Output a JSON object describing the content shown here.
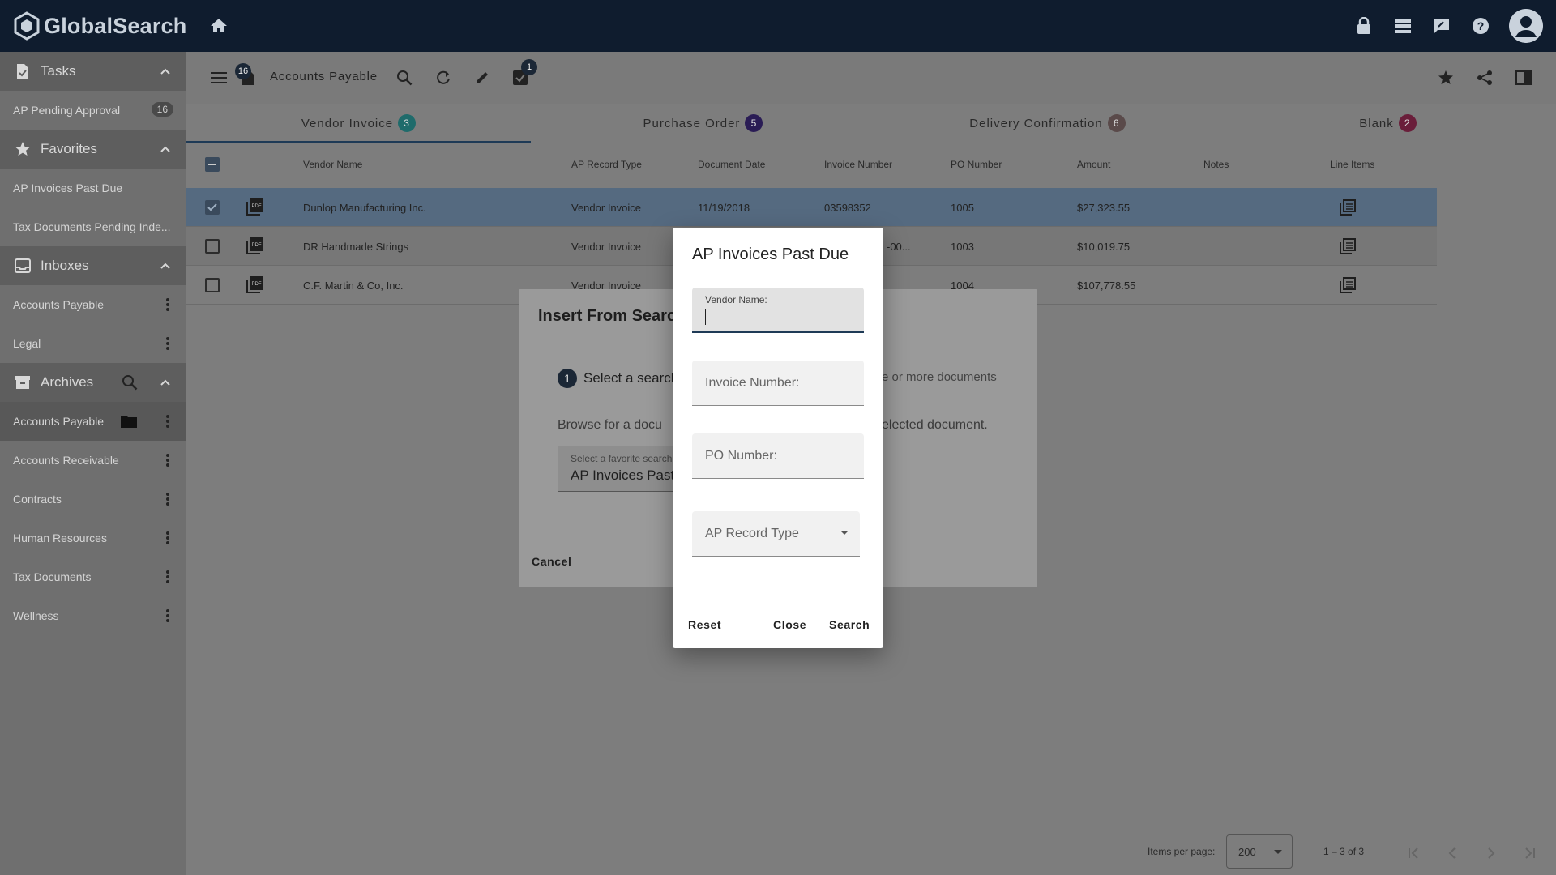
{
  "app": {
    "title": "GlobalSearch"
  },
  "sidebar": {
    "tasks": {
      "label": "Tasks",
      "items": [
        {
          "label": "AP Pending Approval",
          "count": "16"
        }
      ]
    },
    "favorites": {
      "label": "Favorites",
      "items": [
        {
          "label": "AP Invoices Past Due"
        },
        {
          "label": "Tax Documents Pending Inde..."
        }
      ]
    },
    "inboxes": {
      "label": "Inboxes",
      "items": [
        {
          "label": "Accounts Payable"
        },
        {
          "label": "Legal"
        }
      ]
    },
    "archives": {
      "label": "Archives",
      "items": [
        {
          "label": "Accounts Payable"
        },
        {
          "label": "Accounts Receivable"
        },
        {
          "label": "Contracts"
        },
        {
          "label": "Human Resources"
        },
        {
          "label": "Tax Documents"
        },
        {
          "label": "Wellness"
        }
      ]
    }
  },
  "toolbar": {
    "title": "Accounts Payable",
    "tasks_count": "16",
    "approve_count": "1"
  },
  "tabs": [
    {
      "label": "Vendor Invoice",
      "count": "3",
      "color": "#1f6b6b"
    },
    {
      "label": "Purchase Order",
      "count": "5",
      "color": "#2a1c55"
    },
    {
      "label": "Delivery Confirmation",
      "count": "6",
      "color": "#5a4a4a"
    },
    {
      "label": "Blank",
      "count": "2",
      "color": "#6a1e3a"
    }
  ],
  "table": {
    "columns": [
      "Vendor Name",
      "AP Record Type",
      "Document Date",
      "Invoice Number",
      "PO Number",
      "Amount",
      "Notes",
      "Line Items"
    ],
    "rows": [
      {
        "vendor": "Dunlop Manufacturing Inc.",
        "type": "Vendor Invoice",
        "date": "11/19/2018",
        "invoice": "03598352",
        "po": "1005",
        "amount": "$27,323.55",
        "selected": true
      },
      {
        "vendor": "DR Handmade Strings",
        "type": "Vendor Invoice",
        "date": "",
        "invoice": "-00...",
        "po": "1003",
        "amount": "$10,019.75",
        "selected": false
      },
      {
        "vendor": "C.F. Martin & Co, Inc.",
        "type": "Vendor Invoice",
        "date": "",
        "invoice": "",
        "po": "1004",
        "amount": "$107,778.55",
        "selected": false
      }
    ]
  },
  "pager": {
    "items_per_page_label": "Items per page:",
    "items_per_page": "200",
    "range": "1 – 3 of 3"
  },
  "insert_dialog": {
    "title": "Insert From Search",
    "step_number": "1",
    "step_text": "Select a search",
    "step_text_right": "e or more documents",
    "browse_text": "Browse for a docu",
    "browse_text_right": "elected document.",
    "favorite_label": "Select a favorite search",
    "favorite_value": "AP Invoices Past",
    "cancel_label": "Cancel"
  },
  "search_dialog": {
    "title": "AP Invoices Past Due",
    "vendor_label": "Vendor Name:",
    "vendor_value": "",
    "invoice_placeholder": "Invoice Number:",
    "po_placeholder": "PO Number:",
    "record_type_placeholder": "AP Record Type",
    "reset_label": "Reset",
    "close_label": "Close",
    "search_label": "Search"
  }
}
